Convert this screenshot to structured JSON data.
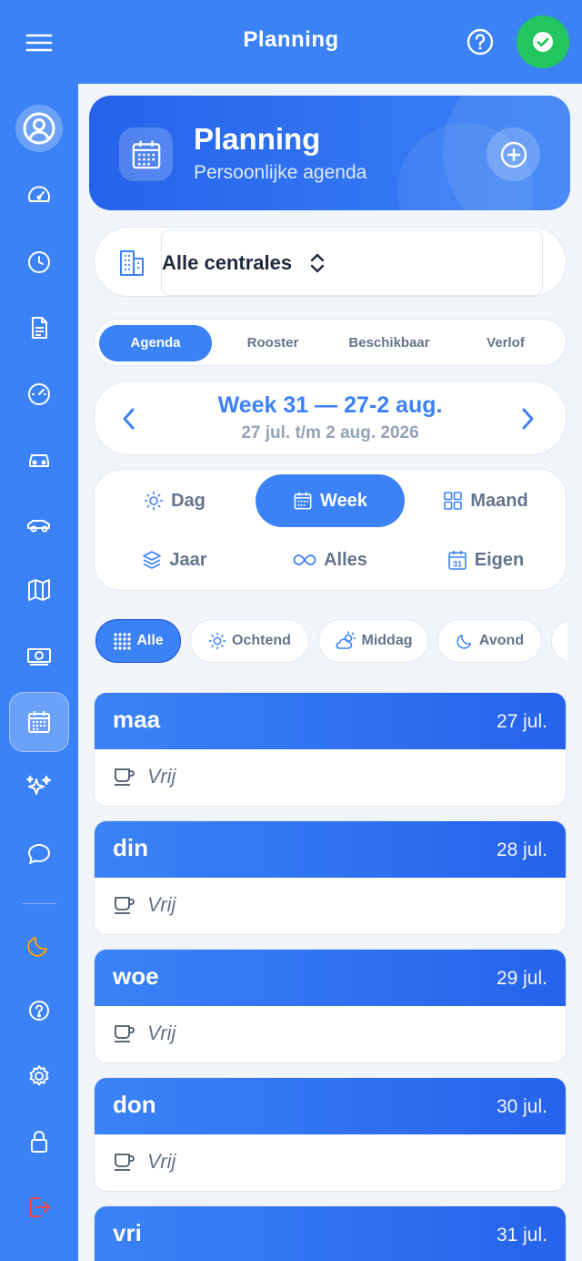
{
  "app": {
    "title": "Planning"
  },
  "colors": {
    "primary": "#3b82f6",
    "success": "#22c55e",
    "logout": "#ef4444",
    "moon": "#f59e0b"
  },
  "sidebar": {
    "items": [
      {
        "icon": "user-circle-icon"
      },
      {
        "icon": "speedometer-icon"
      },
      {
        "icon": "clock-icon"
      },
      {
        "icon": "document-icon"
      },
      {
        "icon": "gauge-icon"
      },
      {
        "icon": "car-icon"
      },
      {
        "icon": "car-side-icon"
      },
      {
        "icon": "map-icon"
      },
      {
        "icon": "banknote-icon"
      },
      {
        "icon": "calendar-icon",
        "active": true
      },
      {
        "icon": "sparkles-icon"
      },
      {
        "icon": "chat-icon"
      },
      {
        "icon": "moon-icon"
      },
      {
        "icon": "help-icon"
      },
      {
        "icon": "settings-icon"
      },
      {
        "icon": "lock-icon"
      },
      {
        "icon": "logout-icon"
      }
    ]
  },
  "hero": {
    "title": "Planning",
    "subtitle": "Persoonlijke agenda"
  },
  "central_selector": {
    "value": "Alle centrales"
  },
  "tabs": [
    "Agenda",
    "Rooster",
    "Beschikbaar",
    "Verlof"
  ],
  "active_tab": "Agenda",
  "week": {
    "title": "Week 31 — 27-2 aug.",
    "range": "27 jul. t/m 2 aug. 2026"
  },
  "views": [
    "Dag",
    "Week",
    "Maand",
    "Jaar",
    "Alles",
    "Eigen"
  ],
  "active_view": "Week",
  "filters": [
    "Alle",
    "Ochtend",
    "Middag",
    "Avond"
  ],
  "active_filter": "Alle",
  "days": [
    {
      "name": "maa",
      "date": "27 jul.",
      "status": "Vrij"
    },
    {
      "name": "din",
      "date": "28 jul.",
      "status": "Vrij"
    },
    {
      "name": "woe",
      "date": "29 jul.",
      "status": "Vrij"
    },
    {
      "name": "don",
      "date": "30 jul.",
      "status": "Vrij"
    },
    {
      "name": "vri",
      "date": "31 jul.",
      "status": ""
    }
  ]
}
